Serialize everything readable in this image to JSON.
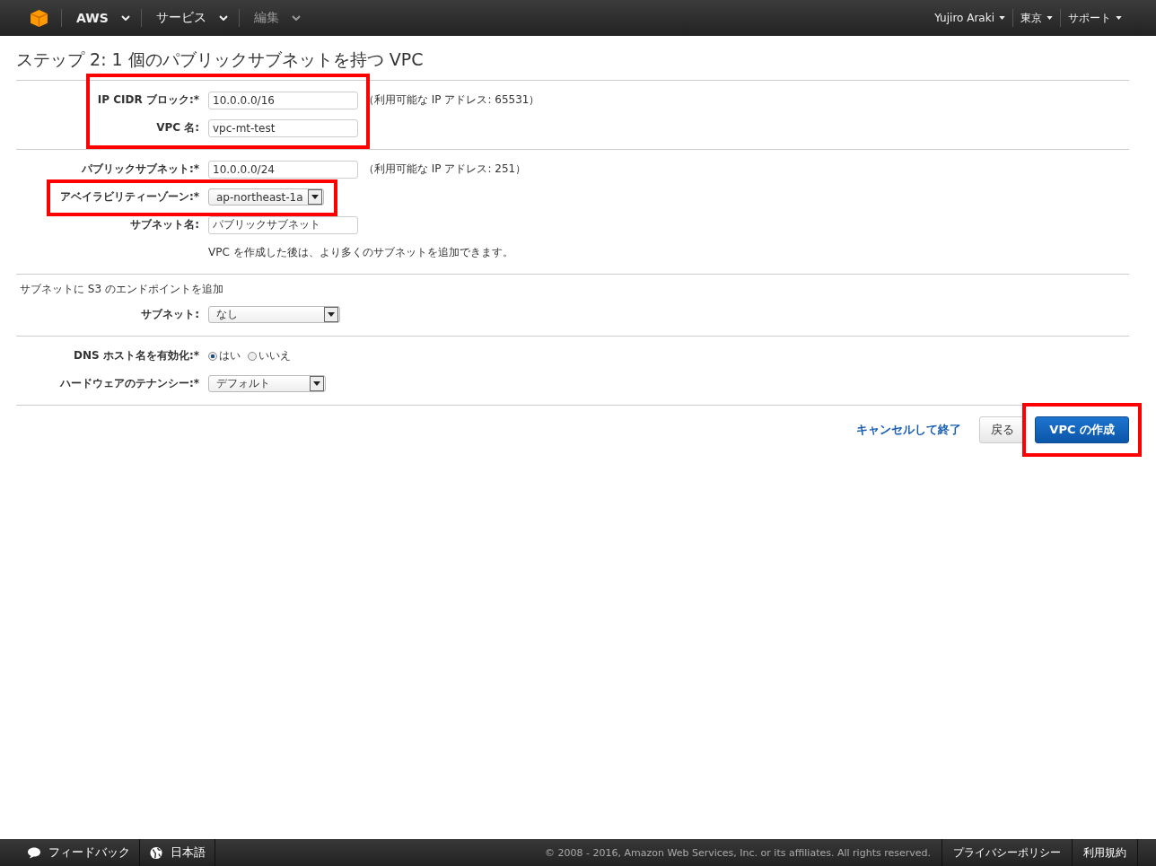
{
  "nav": {
    "menus": [
      {
        "label": "AWS",
        "disabled": false
      },
      {
        "label": "サービス",
        "disabled": false
      },
      {
        "label": "編集",
        "disabled": true
      }
    ],
    "right_menus": [
      "Yujiro Araki",
      "東京",
      "サポート"
    ]
  },
  "title": "ステップ 2: 1 個のパブリックサブネットを持つ VPC",
  "sections": [
    {
      "highlighted": true,
      "rows": [
        {
          "kind": "text",
          "label": "IP CIDR ブロック:*",
          "value": "10.0.0.0/16",
          "hint": "（利用可能な IP アドレス: 65531）",
          "highlighted": false
        },
        {
          "kind": "text",
          "label": "VPC 名:",
          "value": "vpc-mt-test",
          "highlighted": false
        }
      ]
    },
    {
      "highlighted": false,
      "rows": [
        {
          "kind": "text",
          "label": "パブリックサブネット:*",
          "value": "10.0.0.0/24",
          "hint": "（利用可能な IP アドレス: 251）",
          "highlighted": false
        },
        {
          "kind": "select",
          "label": "アベイラビリティーゾーン:*",
          "value": "ap-northeast-1a",
          "highlighted": true
        },
        {
          "kind": "text",
          "label": "サブネット名:",
          "value": "パブリックサブネット",
          "highlighted": false
        },
        {
          "kind": "note",
          "value": "VPC を作成した後は、より多くのサブネットを追加できます。",
          "highlighted": false
        }
      ]
    },
    {
      "highlighted": false,
      "heading": "サブネットに S3 のエンドポイントを追加",
      "rows": [
        {
          "kind": "select",
          "label": "サブネット:",
          "value": "なし",
          "highlighted": false
        }
      ]
    },
    {
      "highlighted": false,
      "rows": [
        {
          "kind": "radio",
          "label": "DNS ホスト名を有効化:*",
          "options": [
            {
              "label": "はい",
              "selected": true
            },
            {
              "label": "いいえ",
              "selected": false
            }
          ],
          "highlighted": false
        },
        {
          "kind": "select",
          "label": "ハードウェアのテナンシー:*",
          "value": "デフォルト",
          "highlighted": false
        }
      ]
    }
  ],
  "actions": {
    "cancel": "キャンセルして終了",
    "back": "戻る",
    "create": {
      "label": "VPC の作成",
      "highlighted": true
    }
  },
  "footer": {
    "feedback": "フィードバック",
    "language": "日本語",
    "copyright": "© 2008 - 2016, Amazon Web Services, Inc. or its affiliates. All rights reserved.",
    "links": [
      "プライバシーポリシー",
      "利用規約"
    ]
  }
}
